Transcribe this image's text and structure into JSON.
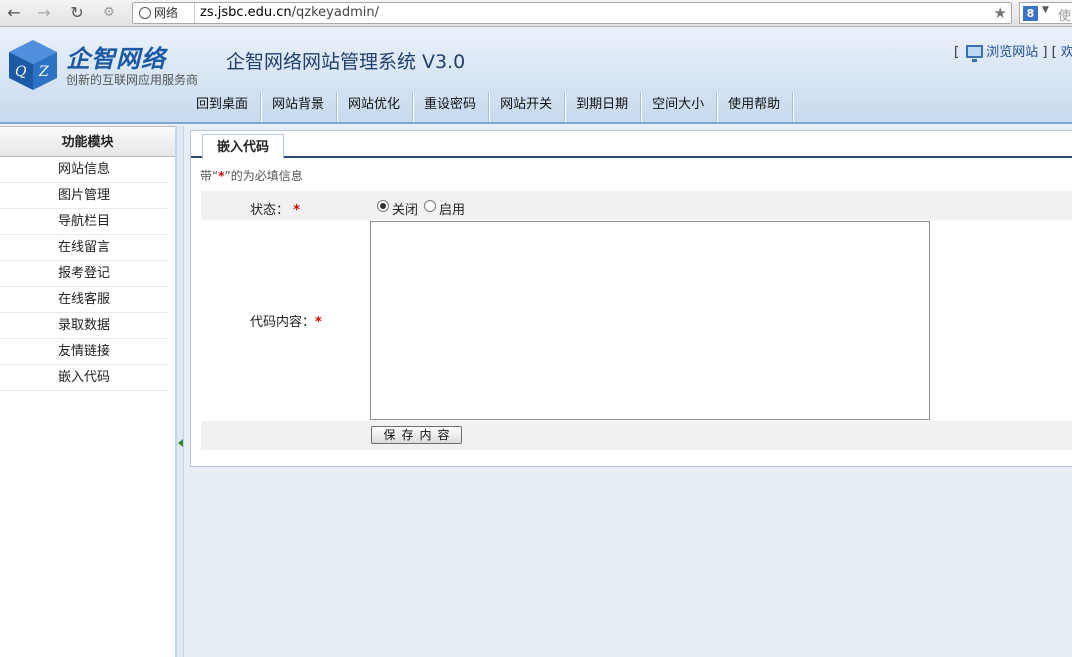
{
  "browser": {
    "site_label": "网络",
    "url_domain": "zs.jsbc.edu.cn",
    "url_path": "/qzkeyadmin/",
    "search_placeholder": "使"
  },
  "header": {
    "brand_name": "企智网络",
    "brand_sub": "创新的互联网应用服务商",
    "logo_letters": "QZ",
    "system_title": "企智网络网站管理系统 V3.0",
    "browse_site": "浏览网站",
    "welcome": "欢"
  },
  "nav": [
    {
      "label": "回到桌面"
    },
    {
      "label": "网站背景"
    },
    {
      "label": "网站优化"
    },
    {
      "label": "重设密码"
    },
    {
      "label": "网站开关"
    },
    {
      "label": "到期日期"
    },
    {
      "label": "空间大小"
    },
    {
      "label": "使用帮助"
    }
  ],
  "sidebar": {
    "title": "功能模块",
    "items": [
      {
        "label": "网站信息"
      },
      {
        "label": "图片管理"
      },
      {
        "label": "导航栏目"
      },
      {
        "label": "在线留言"
      },
      {
        "label": "报考登记"
      },
      {
        "label": "在线客服"
      },
      {
        "label": "录取数据"
      },
      {
        "label": "友情链接"
      },
      {
        "label": "嵌入代码"
      }
    ]
  },
  "main": {
    "tab": "嵌入代码",
    "note_prefix": "带“",
    "note_star": "*",
    "note_suffix": "”的为必填信息",
    "status_label": "状态：",
    "required_star": "*",
    "status_off": "关闭",
    "status_on": "启用",
    "status_selected": "关闭",
    "code_label": "代码内容：",
    "code_value": "",
    "save_label": "保存内容"
  },
  "colors": {
    "accent": "#1d5aa6",
    "required": "#dd0000"
  }
}
